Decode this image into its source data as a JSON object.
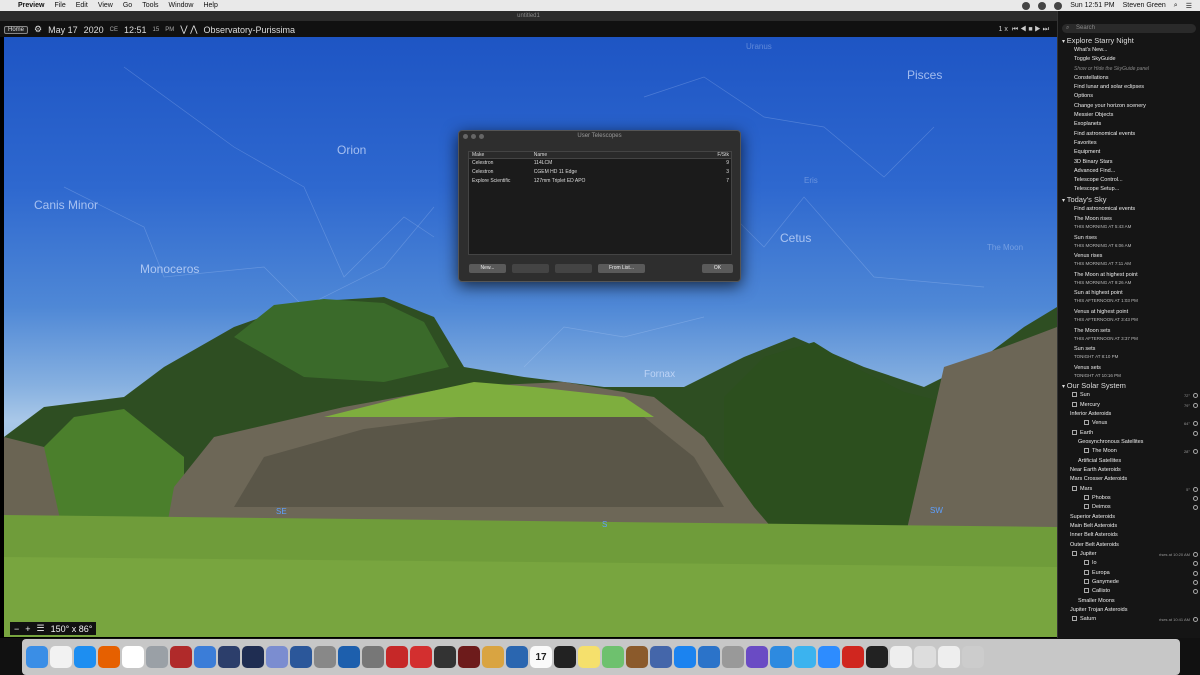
{
  "menubar": {
    "apple": "",
    "app": "Preview",
    "items": [
      "File",
      "Edit",
      "View",
      "Go",
      "Tools",
      "Window",
      "Help"
    ],
    "clock": "Sun 12:51 PM",
    "user": "Steven Green"
  },
  "window": {
    "title": "untitled1"
  },
  "toolbar": {
    "home": "Home",
    "date": "May 17",
    "year": "2020",
    "era": "CE",
    "time": "12:51",
    "seconds": "15",
    "ampm": "PM",
    "location": "Observatory-Purissima",
    "speed": "1 x",
    "controls": "⏮ ◀ ■ ▶ ⏭"
  },
  "sky": {
    "labels": [
      {
        "text": "Orion"
      },
      {
        "text": "Canis Minor"
      },
      {
        "text": "Monoceros"
      },
      {
        "text": "Pisces"
      },
      {
        "text": "Cetus"
      },
      {
        "text": "Fornax"
      },
      {
        "text": "Uranus"
      },
      {
        "text": "Eris"
      },
      {
        "text": "The Moon"
      }
    ],
    "directions": [
      "SE",
      "S",
      "SW"
    ],
    "fov": "150° x 86°"
  },
  "dialog": {
    "title": "User Telescopes",
    "columns": [
      "Make",
      "Name",
      "F/Stk"
    ],
    "rows": [
      [
        "Celestron",
        "114LCM",
        "9"
      ],
      [
        "Celestron",
        "CGEM HD 11 Edge",
        "3"
      ],
      [
        "Explore Scientific",
        "127mm Triplet ED APO",
        "7"
      ]
    ],
    "buttons": {
      "new": "New...",
      "blank1": "",
      "blank2": "",
      "from_list": "From List...",
      "ok": "OK"
    }
  },
  "sidebar": {
    "search": "Search",
    "explore": {
      "title": "Explore Starry Night",
      "items": [
        "What's New...",
        "Toggle SkyGuide",
        "Show or Hide the SkyGuide panel",
        "Constellations",
        "Find lunar and solar eclipses",
        "Options",
        "Change your horizon scenery",
        "Messier Objects",
        "Exoplanets",
        "Find astronomical events",
        "Favorites",
        "Equipment",
        "3D Binary Stars",
        "Advanced Find...",
        "Telescope Control...",
        "Telescope Setup..."
      ]
    },
    "today": {
      "title": "Today's Sky",
      "find": "Find astronomical events",
      "events": [
        {
          "t": "The Moon rises",
          "w": "THIS MORNING AT 5:43 AM"
        },
        {
          "t": "Sun rises",
          "w": "THIS MORNING AT 6:06 AM"
        },
        {
          "t": "Venus rises",
          "w": "THIS MORNING AT 7:11 AM"
        },
        {
          "t": "The Moon at highest point",
          "w": "THIS MORNING AT 9:26 AM"
        },
        {
          "t": "Sun at highest point",
          "w": "THIS AFTERNOON AT 1:03 PM"
        },
        {
          "t": "Venus at highest point",
          "w": "THIS AFTERNOON AT 3:43 PM"
        },
        {
          "t": "The Moon sets",
          "w": "THIS AFTERNOON AT 3:37 PM"
        },
        {
          "t": "Sun sets",
          "w": "TONIGHT AT 8:10 PM"
        },
        {
          "t": "Venus sets",
          "w": "TONIGHT AT 10:16 PM"
        }
      ]
    },
    "solar": {
      "title": "Our Solar System",
      "items": [
        {
          "n": "Sun",
          "r": "72°",
          "lvl": 1
        },
        {
          "n": "Mercury",
          "r": "79°",
          "lvl": 1
        },
        {
          "n": "Inferior Asteroids",
          "r": "",
          "lvl": 0
        },
        {
          "n": "Venus",
          "r": "64°",
          "lvl": 2
        },
        {
          "n": "Earth",
          "r": "",
          "lvl": 1
        },
        {
          "n": "Geosynchronous Satellites",
          "r": "",
          "lvl": 3
        },
        {
          "n": "The Moon",
          "r": "28°",
          "lvl": 2
        },
        {
          "n": "Artificial Satellites",
          "r": "",
          "lvl": 3
        },
        {
          "n": "Near Earth Asteroids",
          "r": "",
          "lvl": 0
        },
        {
          "n": "Mars Crosser Asteroids",
          "r": "",
          "lvl": 0
        },
        {
          "n": "Mars",
          "r": "5°",
          "lvl": 1
        },
        {
          "n": "Phobos",
          "r": "",
          "lvl": 2
        },
        {
          "n": "Deimos",
          "r": "",
          "lvl": 2
        },
        {
          "n": "Superior Asteroids",
          "r": "",
          "lvl": 0
        },
        {
          "n": "Main Belt Asteroids",
          "r": "",
          "lvl": 0
        },
        {
          "n": "Inner Belt Asteroids",
          "r": "",
          "lvl": 0
        },
        {
          "n": "Outer Belt Asteroids",
          "r": "",
          "lvl": 0
        },
        {
          "n": "Jupiter",
          "r": "rises at 10:20 AM",
          "lvl": 1
        },
        {
          "n": "Io",
          "r": "",
          "lvl": 2
        },
        {
          "n": "Europa",
          "r": "",
          "lvl": 2
        },
        {
          "n": "Ganymede",
          "r": "",
          "lvl": 2
        },
        {
          "n": "Callisto",
          "r": "",
          "lvl": 2
        },
        {
          "n": "Smaller Moons",
          "r": "",
          "lvl": 3
        },
        {
          "n": "Jupiter Trojan Asteroids",
          "r": "",
          "lvl": 0
        },
        {
          "n": "Saturn",
          "r": "rises at 10:41 AM",
          "lvl": 1
        }
      ]
    }
  },
  "dock": {
    "apps": [
      {
        "n": "Finder",
        "c": "#3a8ee6"
      },
      {
        "n": "Music",
        "c": "#f2f2f2"
      },
      {
        "n": "Safari",
        "c": "#1d8ef1"
      },
      {
        "n": "Firefox",
        "c": "#e66000"
      },
      {
        "n": "Photos",
        "c": "#ffffff"
      },
      {
        "n": "Preview",
        "c": "#9aa0a6"
      },
      {
        "n": "Photo Booth",
        "c": "#b02a2a"
      },
      {
        "n": "Network",
        "c": "#3b7dd8"
      },
      {
        "n": "Starry Night",
        "c": "#2c3e6b"
      },
      {
        "n": "Starry Night 2",
        "c": "#1f2d52"
      },
      {
        "n": "Browser",
        "c": "#7b8dd0"
      },
      {
        "n": "Word",
        "c": "#2b579a"
      },
      {
        "n": "Keynote",
        "c": "#888"
      },
      {
        "n": "1Password",
        "c": "#1d5fad"
      },
      {
        "n": "System Preferences",
        "c": "#777"
      },
      {
        "n": "Q",
        "c": "#c62828"
      },
      {
        "n": "Tasks",
        "c": "#d32f2f"
      },
      {
        "n": "SN8",
        "c": "#333"
      },
      {
        "n": "SkyGuide",
        "c": "#6d1b1b"
      },
      {
        "n": "Globe",
        "c": "#d9a441"
      },
      {
        "n": "Compass",
        "c": "#2a66b0"
      },
      {
        "n": "Calendar",
        "c": "#fafafa"
      },
      {
        "n": "Activity",
        "c": "#222"
      },
      {
        "n": "Notes",
        "c": "#f5e06c"
      },
      {
        "n": "Maps",
        "c": "#6ec16e"
      },
      {
        "n": "Dictionary",
        "c": "#8b5a2b"
      },
      {
        "n": "Time Machine",
        "c": "#4466aa"
      },
      {
        "n": "App Store",
        "c": "#1b83f0"
      },
      {
        "n": "Globe 2",
        "c": "#2b73c9"
      },
      {
        "n": "Pointer",
        "c": "#999"
      },
      {
        "n": "Star",
        "c": "#6a4bc4"
      },
      {
        "n": "Settings",
        "c": "#2d8ae0"
      },
      {
        "n": "Messages",
        "c": "#3bb3ef"
      },
      {
        "n": "Zoom",
        "c": "#2d8cff"
      },
      {
        "n": "Acrobat",
        "c": "#d0261f"
      },
      {
        "n": "Speedometer",
        "c": "#222"
      },
      {
        "n": "Pages",
        "c": "#eee"
      },
      {
        "n": "Document",
        "c": "#ddd"
      },
      {
        "n": "PDF",
        "c": "#eee"
      },
      {
        "n": "Trash",
        "c": "#ccc"
      }
    ],
    "calendar_label": "17"
  }
}
